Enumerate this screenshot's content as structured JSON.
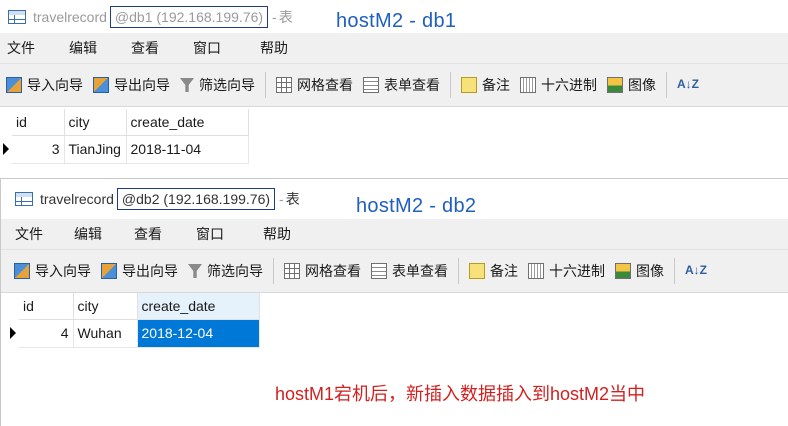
{
  "windows": [
    {
      "title": {
        "table_name": "travelrecord",
        "db": "@db1",
        "host": "(192.168.199.76)",
        "separator": "-",
        "suffix": "表"
      },
      "label": "hostM2 - db1",
      "menu": [
        "文件",
        "编辑",
        "查看",
        "窗口",
        "帮助"
      ],
      "toolbar": {
        "import": "导入向导",
        "export": "导出向导",
        "filter": "筛选向导",
        "grid_view": "网格查看",
        "form_view": "表单查看",
        "memo": "备注",
        "hex": "十六进制",
        "image": "图像",
        "az": "A↓Z"
      },
      "columns": [
        "id",
        "city",
        "create_date"
      ],
      "rows": [
        {
          "id": "3",
          "city": "TianJing",
          "create_date": "2018-11-04"
        }
      ]
    },
    {
      "title": {
        "table_name": "travelrecord",
        "db": "@db2",
        "host": "(192.168.199.76)",
        "separator": "-",
        "suffix": "表"
      },
      "label": "hostM2 - db2",
      "menu": [
        "文件",
        "编辑",
        "查看",
        "窗口",
        "帮助"
      ],
      "toolbar": {
        "import": "导入向导",
        "export": "导出向导",
        "filter": "筛选向导",
        "grid_view": "网格查看",
        "form_view": "表单查看",
        "memo": "备注",
        "hex": "十六进制",
        "image": "图像",
        "az": "A↓Z"
      },
      "columns": [
        "id",
        "city",
        "create_date"
      ],
      "rows": [
        {
          "id": "4",
          "city": "Wuhan",
          "create_date": "2018-12-04"
        }
      ]
    }
  ],
  "annotation": "hostM1宕机后，新插入数据插入到hostM2当中",
  "colors": {
    "label_blue": "#1f5fbf",
    "annotation_red": "#d22020",
    "selection": "#0078d7",
    "db_box_border": "#1f3a8a"
  }
}
